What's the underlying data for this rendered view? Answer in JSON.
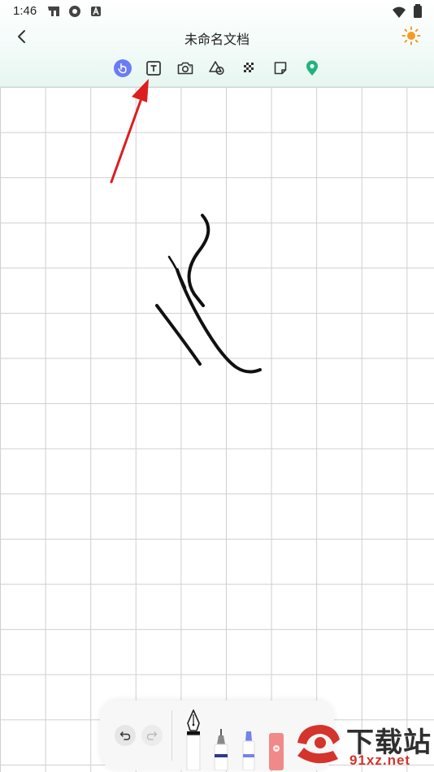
{
  "status_bar": {
    "time": "1:46"
  },
  "app_bar": {
    "title": "未命名文档"
  },
  "toolbar": {
    "tools": [
      "hand-pointer",
      "text",
      "camera",
      "shapes",
      "eraser-pattern",
      "sticky-note",
      "location"
    ],
    "active_tool": "hand-pointer",
    "accent_color": "#6b7cf5",
    "location_color": "#1fb37e"
  },
  "bottom_panel": {
    "buttons": [
      "undo",
      "redo"
    ],
    "pens": [
      "fountain-pen",
      "fineliner",
      "marker",
      "eraser"
    ]
  },
  "watermark": {
    "brand": "下载站",
    "domain": "91xz.net"
  }
}
